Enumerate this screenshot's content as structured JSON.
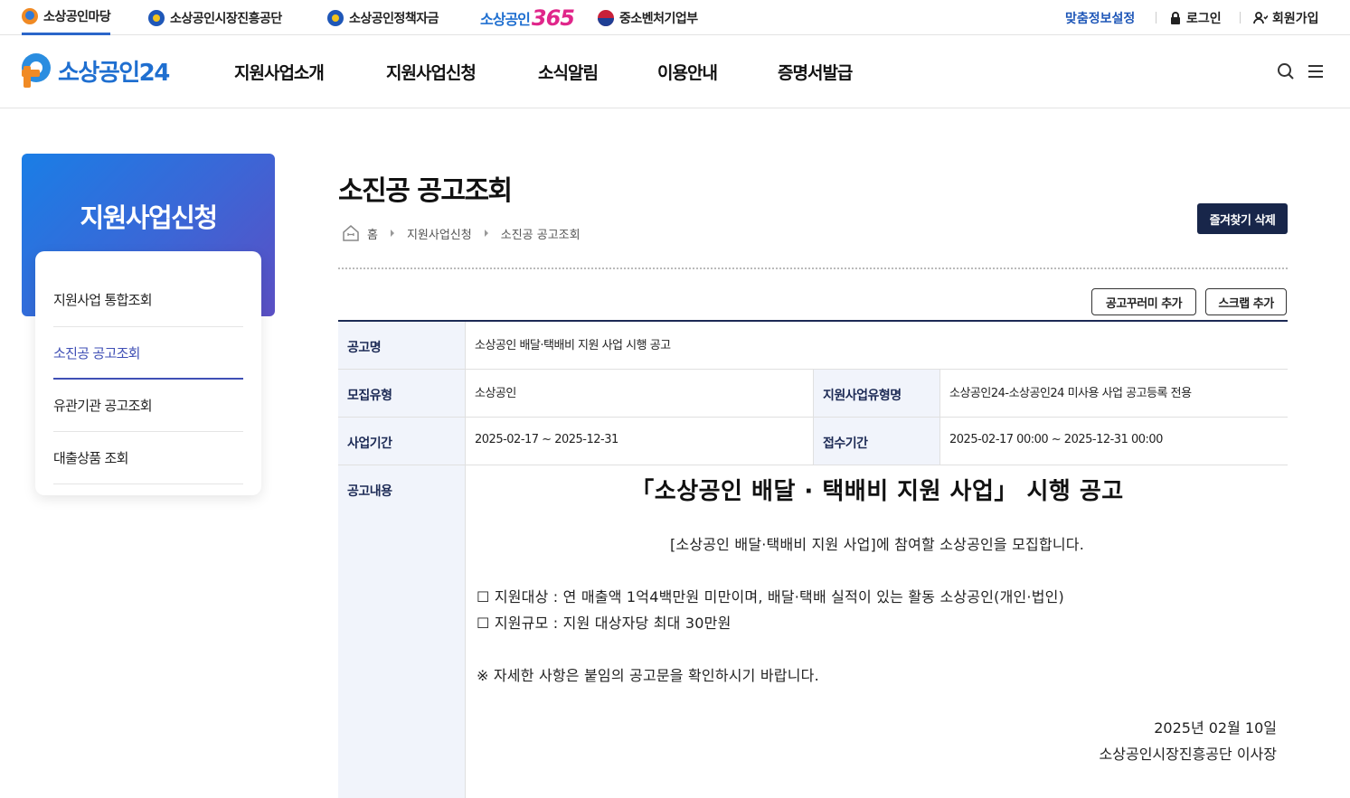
{
  "top_sites": [
    {
      "label": "소상공인마당"
    },
    {
      "label": "소상공인시장진흥공단"
    },
    {
      "label": "소상공인정책자금"
    },
    {
      "label_text": "소상공인",
      "label_num": "365"
    },
    {
      "label": "중소벤처기업부"
    }
  ],
  "utility": {
    "custom_info": "맞춤정보설정",
    "login": "로그인",
    "signup": "회원가입"
  },
  "header": {
    "logo_text": "소상공인24",
    "nav": [
      "지원사업소개",
      "지원사업신청",
      "소식알림",
      "이용안내",
      "증명서발급"
    ]
  },
  "sidebar": {
    "title": "지원사업신청",
    "items": [
      "지원사업 통합조회",
      "소진공 공고조회",
      "유관기관 공고조회",
      "대출상품 조회"
    ],
    "active_index": 1
  },
  "page": {
    "title": "소진공 공고조회",
    "breadcrumb": [
      "홈",
      "지원사업신청",
      "소진공 공고조회"
    ],
    "fav_delete": "즐겨찾기 삭제",
    "add_bundle": "공고꾸러미 추가",
    "add_scrap": "스크랩 추가"
  },
  "notice": {
    "name_label": "공고명",
    "name_value": "소상공인 배달·택배비 지원 사업 시행 공고",
    "type_label": "모집유형",
    "type_value": "소상공인",
    "biz_type_label": "지원사업유형명",
    "biz_type_value": "소상공인24-소상공인24 미사용 사업 공고등록 전용",
    "period_label": "사업기간",
    "period_value": "2025-02-17 ~ 2025-12-31",
    "receipt_label": "접수기간",
    "receipt_value": "2025-02-17 00:00 ~ 2025-12-31 00:00",
    "content_label": "공고내용",
    "content": {
      "heading": "「소상공인 배달 · 택배비 지원 사업」 시행 공고",
      "intro": "[소상공인 배달·택배비 지원 사업]에 참여할 소상공인을 모집합니다.",
      "target": "☐ 지원대상 : 연 매출액 1억4백만원 미만이며, 배달·택배 실적이 있는 활동 소상공인(개인·법인)",
      "scale": "☐ 지원규모 : 지원 대상자당 최대 30만원",
      "note": "※ 자세한 사항은 붙임의 공고문을 확인하시기 바랍니다.",
      "date": "2025년 02월 10일",
      "signer": "소상공인시장진흥공단 이사장"
    }
  }
}
